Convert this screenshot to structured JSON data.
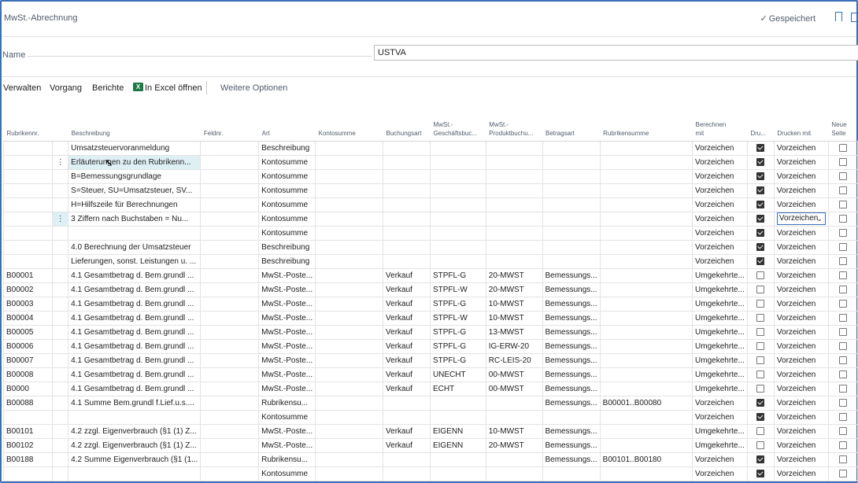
{
  "header": {
    "title": "MwSt.-Abrechnung",
    "saved": "Gespeichert"
  },
  "name_field": {
    "label": "Name",
    "value": "USTVA"
  },
  "actions": {
    "verwalten": "Verwalten",
    "vorgang": "Vorgang",
    "berichte": "Berichte",
    "excel": "In Excel öffnen",
    "more": "Weitere Optionen"
  },
  "columns": {
    "rubrikennr": "Rubrikennr.",
    "beschreibung": "Beschreibung",
    "feldnr": "Feldnr.",
    "art": "Art",
    "kontosumme": "Kontosumme",
    "buchungsart": "Buchungsart",
    "mwst_gesch_1": "MwSt.-",
    "mwst_gesch_2": "Geschäftsbuc...",
    "mwst_prod_1": "MwSt.-",
    "mwst_prod_2": "Produktbuchu...",
    "betragsart": "Betragsart",
    "rubrikensumme": "Rubrikensumme",
    "berechnen_1": "Berechnen",
    "berechnen_2": "mit",
    "drucken": "Dru...",
    "drucken_mit": "Drucken mit",
    "neue_1": "Neue",
    "neue_2": "Seite"
  },
  "rows": [
    {
      "nr": "",
      "desc": "Umsatzsteuervoranmeldung",
      "feld": "",
      "art": "Beschreibung",
      "konto": "",
      "buch": "",
      "gesch": "",
      "prod": "",
      "betrag": "",
      "rsum": "",
      "calc": "Vorzeichen",
      "print": true,
      "pwith": "Vorzeichen",
      "newpage": false
    },
    {
      "nr": "",
      "desc": "Erläuterungen zu den Rubrikenn...",
      "feld": "",
      "art": "Kontosumme",
      "konto": "",
      "buch": "",
      "gesch": "",
      "prod": "",
      "betrag": "",
      "rsum": "",
      "calc": "Vorzeichen",
      "print": true,
      "pwith": "Vorzeichen",
      "newpage": false
    },
    {
      "nr": "",
      "desc": "B=Bemessungsgrundlage",
      "feld": "",
      "art": "Kontosumme",
      "konto": "",
      "buch": "",
      "gesch": "",
      "prod": "",
      "betrag": "",
      "rsum": "",
      "calc": "Vorzeichen",
      "print": true,
      "pwith": "Vorzeichen",
      "newpage": false
    },
    {
      "nr": "",
      "desc": "S=Steuer, SU=Umsatzsteuer, SV...",
      "feld": "",
      "art": "Kontosumme",
      "konto": "",
      "buch": "",
      "gesch": "",
      "prod": "",
      "betrag": "",
      "rsum": "",
      "calc": "Vorzeichen",
      "print": true,
      "pwith": "Vorzeichen",
      "newpage": false
    },
    {
      "nr": "",
      "desc": "H=Hilfszeile für Berechnungen",
      "feld": "",
      "art": "Kontosumme",
      "konto": "",
      "buch": "",
      "gesch": "",
      "prod": "",
      "betrag": "",
      "rsum": "",
      "calc": "Vorzeichen",
      "print": true,
      "pwith": "Vorzeichen",
      "newpage": false
    },
    {
      "nr": "",
      "desc": "3 Ziffern nach Buchstaben = Nu...",
      "feld": "",
      "art": "Kontosumme",
      "konto": "",
      "buch": "",
      "gesch": "",
      "prod": "",
      "betrag": "",
      "rsum": "",
      "calc": "Vorzeichen",
      "print": true,
      "pwith": "Vorzeichen",
      "newpage": false
    },
    {
      "nr": "",
      "desc": "",
      "feld": "",
      "art": "Kontosumme",
      "konto": "",
      "buch": "",
      "gesch": "",
      "prod": "",
      "betrag": "",
      "rsum": "",
      "calc": "Vorzeichen",
      "print": true,
      "pwith": "Vorzeichen",
      "newpage": false
    },
    {
      "nr": "",
      "desc": "4.0 Berechnung der Umsatzsteuer",
      "feld": "",
      "art": "Beschreibung",
      "konto": "",
      "buch": "",
      "gesch": "",
      "prod": "",
      "betrag": "",
      "rsum": "",
      "calc": "Vorzeichen",
      "print": true,
      "pwith": "Vorzeichen",
      "newpage": false
    },
    {
      "nr": "",
      "desc": "Lieferungen, sonst. Leistungen u. ...",
      "feld": "",
      "art": "Beschreibung",
      "konto": "",
      "buch": "",
      "gesch": "",
      "prod": "",
      "betrag": "",
      "rsum": "",
      "calc": "Vorzeichen",
      "print": true,
      "pwith": "Vorzeichen",
      "newpage": false
    },
    {
      "nr": "B00001",
      "desc": "4.1 Gesamtbetrag d. Bem.grundl ...",
      "feld": "",
      "art": "MwSt.-Poste...",
      "konto": "",
      "buch": "Verkauf",
      "gesch": "STPFL-G",
      "prod": "20-MWST",
      "betrag": "Bemessungs...",
      "rsum": "",
      "calc": "Umgekehrte...",
      "print": false,
      "pwith": "Vorzeichen",
      "newpage": false
    },
    {
      "nr": "B00002",
      "desc": "4.1 Gesamtbetrag d. Bem.grundl ...",
      "feld": "",
      "art": "MwSt.-Poste...",
      "konto": "",
      "buch": "Verkauf",
      "gesch": "STPFL-W",
      "prod": "20-MWST",
      "betrag": "Bemessungs...",
      "rsum": "",
      "calc": "Umgekehrte...",
      "print": false,
      "pwith": "Vorzeichen",
      "newpage": false
    },
    {
      "nr": "B00003",
      "desc": "4.1 Gesamtbetrag d. Bem.grundl ...",
      "feld": "",
      "art": "MwSt.-Poste...",
      "konto": "",
      "buch": "Verkauf",
      "gesch": "STPFL-G",
      "prod": "10-MWST",
      "betrag": "Bemessungs...",
      "rsum": "",
      "calc": "Umgekehrte...",
      "print": false,
      "pwith": "Vorzeichen",
      "newpage": false
    },
    {
      "nr": "B00004",
      "desc": "4.1 Gesamtbetrag d. Bem.grundl ...",
      "feld": "",
      "art": "MwSt.-Poste...",
      "konto": "",
      "buch": "Verkauf",
      "gesch": "STPFL-W",
      "prod": "10-MWST",
      "betrag": "Bemessungs...",
      "rsum": "",
      "calc": "Umgekehrte...",
      "print": false,
      "pwith": "Vorzeichen",
      "newpage": false
    },
    {
      "nr": "B00005",
      "desc": "4.1 Gesamtbetrag d. Bem.grundl ...",
      "feld": "",
      "art": "MwSt.-Poste...",
      "konto": "",
      "buch": "Verkauf",
      "gesch": "STPFL-G",
      "prod": "13-MWST",
      "betrag": "Bemessungs...",
      "rsum": "",
      "calc": "Umgekehrte...",
      "print": false,
      "pwith": "Vorzeichen",
      "newpage": false
    },
    {
      "nr": "B00006",
      "desc": "4.1 Gesamtbetrag d. Bem.grundl ...",
      "feld": "",
      "art": "MwSt.-Poste...",
      "konto": "",
      "buch": "Verkauf",
      "gesch": "STPFL-G",
      "prod": "IG-ERW-20",
      "betrag": "Bemessungs...",
      "rsum": "",
      "calc": "Umgekehrte...",
      "print": false,
      "pwith": "Vorzeichen",
      "newpage": false
    },
    {
      "nr": "B00007",
      "desc": "4.1 Gesamtbetrag d. Bem.grundl ...",
      "feld": "",
      "art": "MwSt.-Poste...",
      "konto": "",
      "buch": "Verkauf",
      "gesch": "STPFL-G",
      "prod": "RC-LEIS-20",
      "betrag": "Bemessungs...",
      "rsum": "",
      "calc": "Umgekehrte...",
      "print": false,
      "pwith": "Vorzeichen",
      "newpage": false
    },
    {
      "nr": "B00008",
      "desc": "4.1 Gesamtbetrag d. Bem.grundl ...",
      "feld": "",
      "art": "MwSt.-Poste...",
      "konto": "",
      "buch": "Verkauf",
      "gesch": "UNECHT",
      "prod": "00-MWST",
      "betrag": "Bemessungs...",
      "rsum": "",
      "calc": "Umgekehrte...",
      "print": false,
      "pwith": "Vorzeichen",
      "newpage": false
    },
    {
      "nr": "B0000",
      "desc": "4.1 Gesamtbetrag d. Bem.grundl ...",
      "feld": "",
      "art": "MwSt.-Poste...",
      "konto": "",
      "buch": "Verkauf",
      "gesch": "ECHT",
      "prod": "00-MWST",
      "betrag": "Bemessungs...",
      "rsum": "",
      "calc": "Umgekehrte...",
      "print": false,
      "pwith": "Vorzeichen",
      "newpage": false
    },
    {
      "nr": "B00088",
      "desc": "4.1 Summe Bem.grundl f.Lief.u.s....",
      "feld": "",
      "art": "Rubrikensu...",
      "konto": "",
      "buch": "",
      "gesch": "",
      "prod": "",
      "betrag": "Bemessungs...",
      "rsum": "B00001..B00080",
      "calc": "Vorzeichen",
      "print": true,
      "pwith": "Vorzeichen",
      "newpage": false
    },
    {
      "nr": "",
      "desc": "",
      "feld": "",
      "art": "Kontosumme",
      "konto": "",
      "buch": "",
      "gesch": "",
      "prod": "",
      "betrag": "",
      "rsum": "",
      "calc": "Vorzeichen",
      "print": true,
      "pwith": "Vorzeichen",
      "newpage": false
    },
    {
      "nr": "B00101",
      "desc": "4.2 zzgl. Eigenverbrauch (§1 (1) Z...",
      "feld": "",
      "art": "MwSt.-Poste...",
      "konto": "",
      "buch": "Verkauf",
      "gesch": "EIGENN",
      "prod": "10-MWST",
      "betrag": "Bemessungs...",
      "rsum": "",
      "calc": "Umgekehrte...",
      "print": false,
      "pwith": "Vorzeichen",
      "newpage": false
    },
    {
      "nr": "B00102",
      "desc": "4.2 zzgl. Eigenverbrauch (§1 (1) Z...",
      "feld": "",
      "art": "MwSt.-Poste...",
      "konto": "",
      "buch": "Verkauf",
      "gesch": "EIGENN",
      "prod": "20-MWST",
      "betrag": "Bemessungs...",
      "rsum": "",
      "calc": "Umgekehrte...",
      "print": false,
      "pwith": "Vorzeichen",
      "newpage": false
    },
    {
      "nr": "B00188",
      "desc": "4.2 Summe Eigenverbrauch (§1 (1...",
      "feld": "",
      "art": "Rubrikensu...",
      "konto": "",
      "buch": "",
      "gesch": "",
      "prod": "",
      "betrag": "Bemessungs...",
      "rsum": "B00101..B00180",
      "calc": "Vorzeichen",
      "print": true,
      "pwith": "Vorzeichen",
      "newpage": false
    },
    {
      "nr": "",
      "desc": "",
      "feld": "",
      "art": "Kontosumme",
      "konto": "",
      "buch": "",
      "gesch": "",
      "prod": "",
      "betrag": "",
      "rsum": "",
      "calc": "Vorzeichen",
      "print": true,
      "pwith": "Vorzeichen",
      "newpage": false
    }
  ]
}
